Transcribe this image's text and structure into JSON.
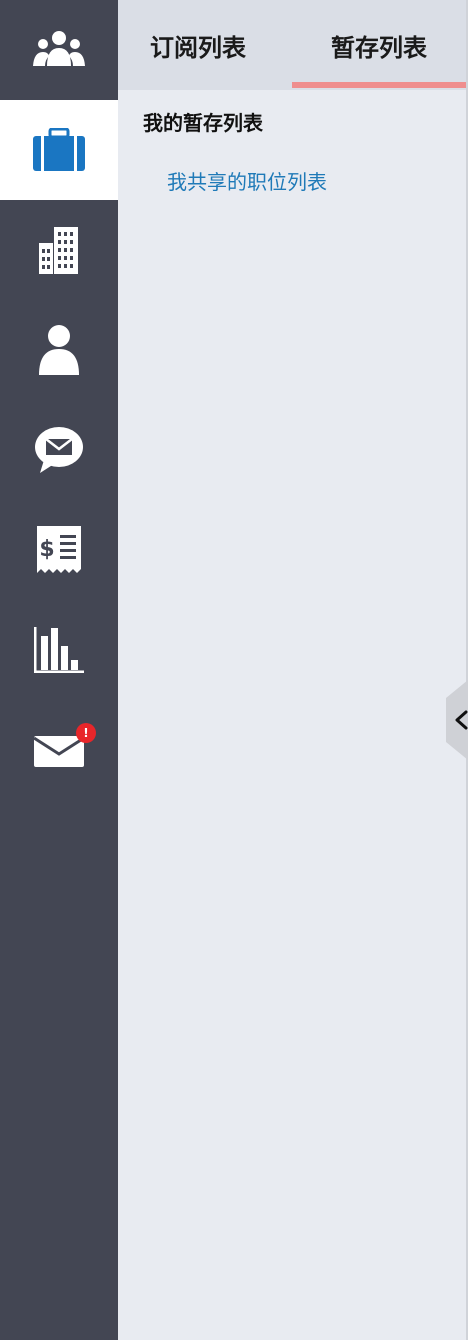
{
  "sidebar": {
    "items": [
      {
        "icon": "people-group-icon"
      },
      {
        "icon": "briefcase-icon",
        "active": true
      },
      {
        "icon": "building-icon"
      },
      {
        "icon": "person-icon"
      },
      {
        "icon": "chat-mail-icon"
      },
      {
        "icon": "invoice-icon"
      },
      {
        "icon": "bar-chart-icon"
      },
      {
        "icon": "envelope-icon",
        "badge": "!"
      }
    ],
    "colors": {
      "background": "#434653",
      "active_background": "#ffffff",
      "icon": "#ffffff",
      "active_icon": "#1a76c2",
      "badge": "#e8262a"
    }
  },
  "tabs": {
    "subscribe_label": "订阅列表",
    "saved_label": "暂存列表",
    "active": "saved",
    "underline_color": "#ef8e8e"
  },
  "content": {
    "section_title": "我的暂存列表",
    "items": [
      {
        "label": "我共享的职位列表"
      }
    ],
    "link_color": "#1f7ab8"
  },
  "collapse_handle": {
    "icon": "chevron-left-icon"
  }
}
